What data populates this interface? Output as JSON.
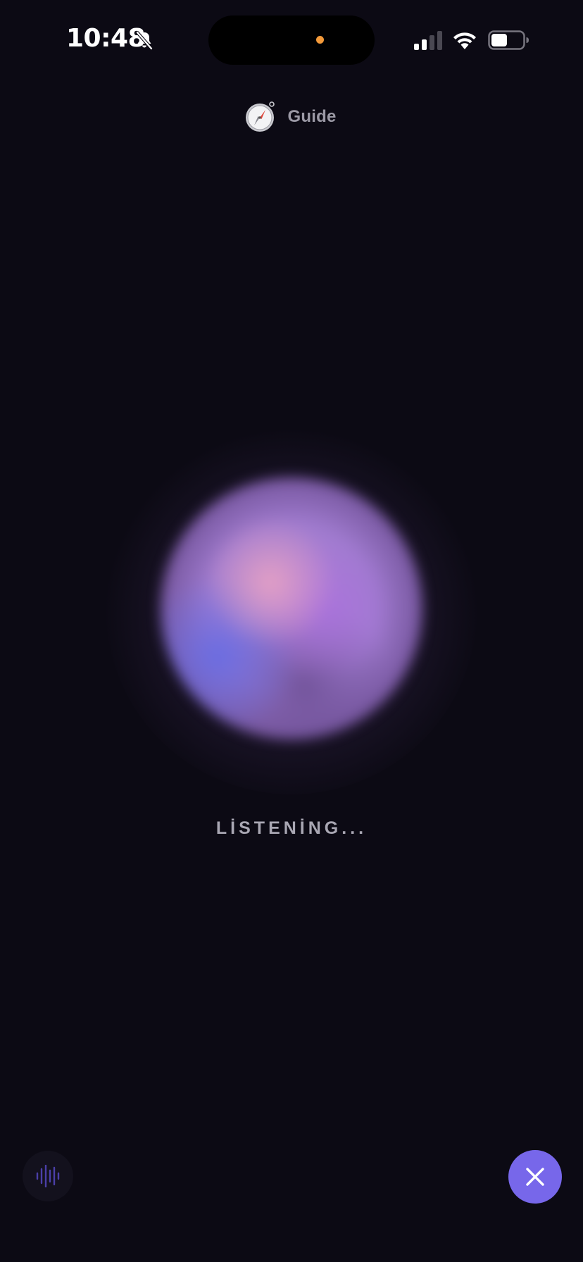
{
  "status_bar": {
    "time": "10:48",
    "icons": [
      "bell-slash-icon",
      "signal-icon",
      "wifi-icon",
      "battery-icon"
    ],
    "indicator_color": "#f39a3a"
  },
  "header": {
    "icon": "compass-icon",
    "title": "Guide"
  },
  "orb": {
    "colors": [
      "#d89ac8",
      "#a87bd6",
      "#6c6ee0",
      "#4a3466"
    ]
  },
  "status_text": "LİSTENİNG...",
  "controls": {
    "left_icon": "waveform-icon",
    "right_icon": "close-icon",
    "accent": "#7767ea"
  },
  "colors": {
    "background": "#0c0a14",
    "text_muted": "#a9a7b3"
  }
}
